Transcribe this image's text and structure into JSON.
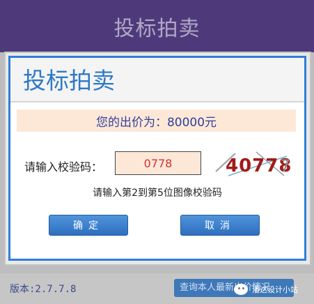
{
  "background": {
    "title": "投标拍卖",
    "version": "版本:2.7.7.8",
    "query_button": "查询本人最新出价情况"
  },
  "watermark": {
    "text": "潘达设计小站",
    "icon": "wechat-icon"
  },
  "dialog": {
    "title": "投标拍卖",
    "price_text": "您的出价为：80000元",
    "captcha_label": "请输入校验码：",
    "captcha_value": "0778",
    "captcha_image_text": "40778",
    "captcha_extra": "7",
    "hint": "请输入第2到第5位图像校验码",
    "ok_label": "确定",
    "cancel_label": "取消"
  },
  "colors": {
    "header_bg": "#4e3a7a",
    "accent_blue": "#2f7fd6",
    "price_bg": "#fde8d8",
    "input_text": "#d43030"
  }
}
